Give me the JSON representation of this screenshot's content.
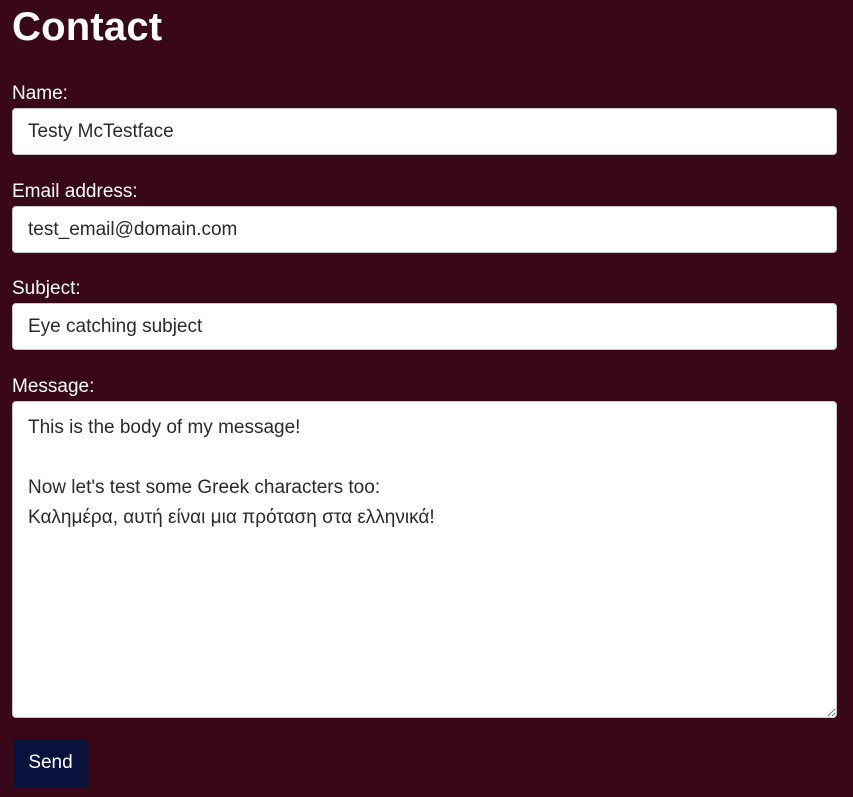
{
  "page": {
    "title": "Contact"
  },
  "form": {
    "name": {
      "label": "Name:",
      "value": "Testy McTestface"
    },
    "email": {
      "label": "Email address:",
      "value": "test_email@domain.com"
    },
    "subject": {
      "label": "Subject:",
      "value": "Eye catching subject"
    },
    "message": {
      "label": "Message:",
      "value": "This is the body of my message!\n\nNow let's test some Greek characters too:\nΚαλημέρα, αυτή είναι μια πρόταση στα ελληνικά!"
    },
    "send_label": "Send"
  },
  "colors": {
    "background": "#380718",
    "button": "#07123d"
  }
}
